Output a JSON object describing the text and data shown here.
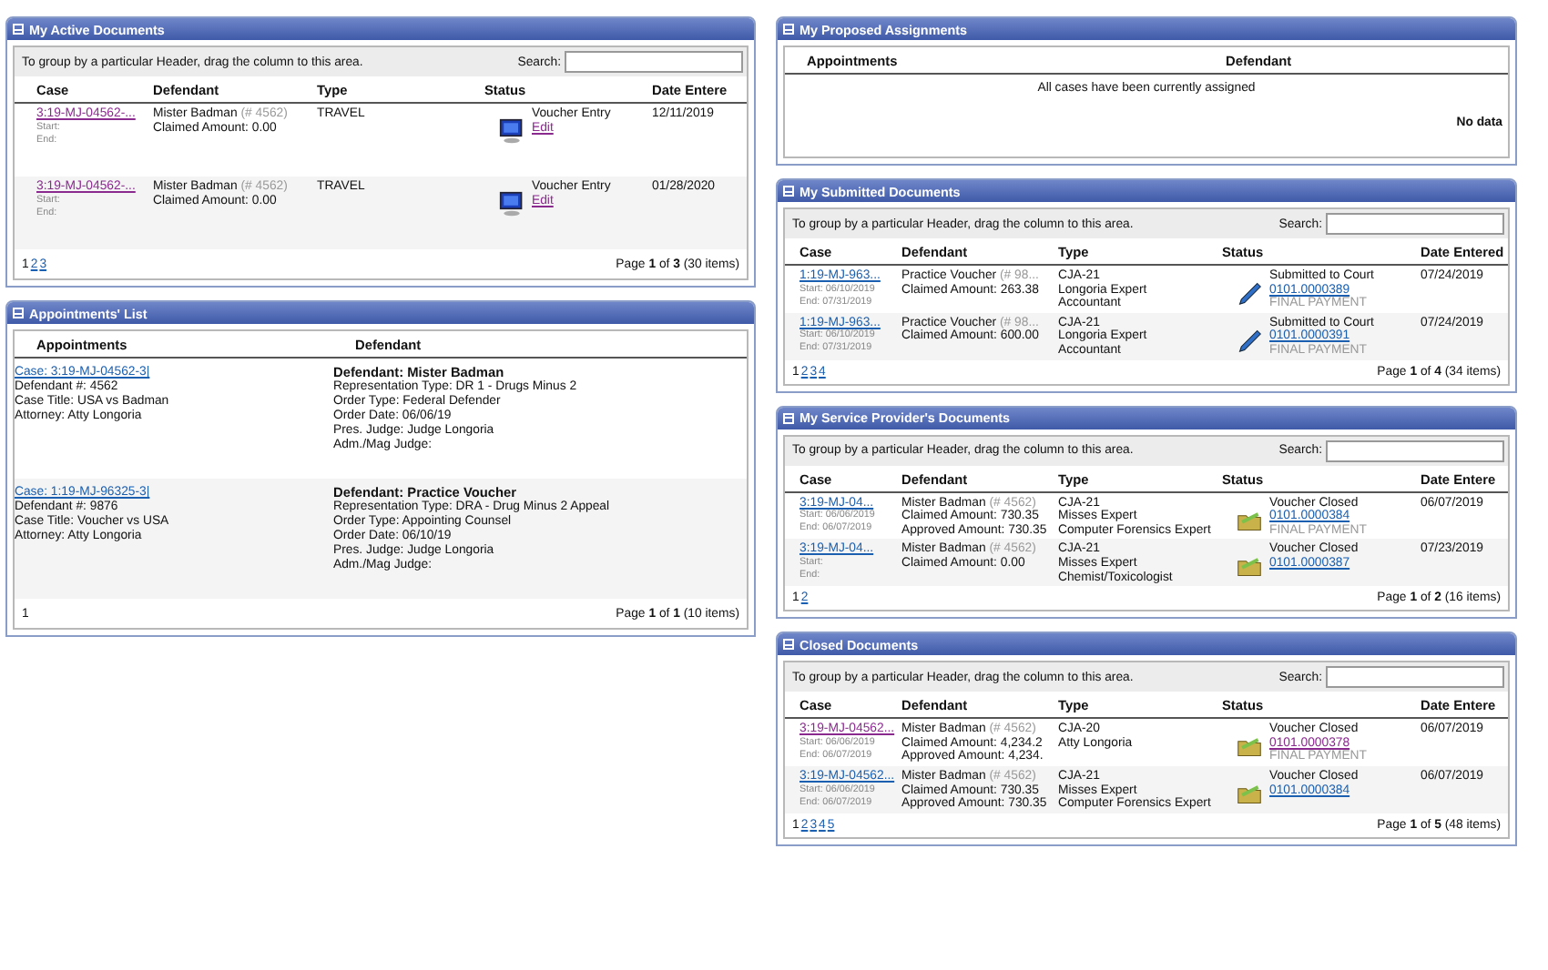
{
  "left_panels": [
    {
      "kind": "documents",
      "title": "My Active Documents",
      "group_hint": "To group by a particular Header, drag the column to this area.",
      "search_label": "Search:",
      "columns": [
        "Case",
        "Defendant",
        "Type",
        "Status",
        "Date Entere"
      ],
      "rows": [
        {
          "case": {
            "text": "3:19-MJ-04562-...",
            "visited": true
          },
          "start": "Start:",
          "end": "End:",
          "defendant": "Mister Badman",
          "defendant_no": "(# 4562)",
          "amounts": [
            "Claimed Amount: 0.00"
          ],
          "type": [
            "TRAVEL"
          ],
          "status": {
            "kind": "entry",
            "text": "Voucher Entry",
            "link": "Edit",
            "visited": true
          },
          "date": "12/11/2019"
        },
        {
          "case": {
            "text": "3:19-MJ-04562-...",
            "visited": true
          },
          "start": "Start:",
          "end": "End:",
          "defendant": "Mister Badman",
          "defendant_no": "(# 4562)",
          "amounts": [
            "Claimed Amount: 0.00"
          ],
          "type": [
            "TRAVEL"
          ],
          "status": {
            "kind": "entry",
            "text": "Voucher Entry",
            "link": "Edit",
            "visited": true
          },
          "date": "01/28/2020"
        }
      ],
      "pages": [
        {
          "label": "1",
          "selected": true
        },
        {
          "label": "2",
          "selected": false
        },
        {
          "label": "3",
          "selected": false
        }
      ],
      "page_info": "Page **1** of **3** (30 items)"
    },
    {
      "kind": "appointments",
      "title": "Appointments' List",
      "columns": [
        "Appointments",
        "Defendant"
      ],
      "rows": [
        {
          "case": "Case: 3:19-MJ-04562-3|",
          "lines": [
            "Defendant #: 4562",
            "Case Title: USA vs Badman",
            "Attorney: Atty Longoria"
          ],
          "defendant": "Defendant: Mister Badman",
          "details": [
            "Representation Type: DR 1 - Drugs Minus 2",
            "Order Type: Federal Defender",
            "Order Date: 06/06/19",
            "Pres. Judge: Judge Longoria",
            "Adm./Mag Judge:"
          ]
        },
        {
          "case": "Case: 1:19-MJ-96325-3|",
          "lines": [
            "Defendant #: 9876",
            "Case Title: Voucher vs USA",
            "Attorney: Atty Longoria"
          ],
          "defendant": "Defendant: Practice Voucher",
          "details": [
            "Representation Type: DRA - Drug Minus 2 Appeal",
            "Order Type: Appointing Counsel",
            "Order Date: 06/10/19",
            "Pres. Judge: Judge Longoria",
            "Adm./Mag Judge:"
          ]
        }
      ],
      "pages": [
        {
          "label": "1",
          "selected": true
        }
      ],
      "page_info": "Page **1** of **1** (10 items)"
    }
  ],
  "right_panels": [
    {
      "kind": "proposed",
      "title": "My Proposed Assignments",
      "columns": [
        "Appointments",
        "Defendant"
      ],
      "message": "All cases have been currently assigned",
      "footer": "No data"
    },
    {
      "kind": "documents",
      "title": "My Submitted Documents",
      "group_hint": "To group by a particular Header, drag the column to this area.",
      "search_label": "Search:",
      "columns": [
        "Case",
        "Defendant",
        "Type",
        "Status",
        "Date Entered"
      ],
      "rows": [
        {
          "case": {
            "text": "1:19-MJ-963...",
            "visited": false
          },
          "start": "Start: 06/10/2019",
          "end": "End: 07/31/2019",
          "defendant": "Practice Voucher",
          "defendant_no": "(# 98...",
          "amounts": [
            "Claimed Amount: 263.38"
          ],
          "type": [
            "CJA-21",
            "Longoria Expert",
            "Accountant"
          ],
          "status": {
            "kind": "submitted",
            "text": "Submitted to Court",
            "link": "0101.0000389",
            "visited": false,
            "note": "FINAL PAYMENT"
          },
          "date": "07/24/2019"
        },
        {
          "case": {
            "text": "1:19-MJ-963...",
            "visited": false
          },
          "start": "Start: 06/10/2019",
          "end": "End: 07/31/2019",
          "defendant": "Practice Voucher",
          "defendant_no": "(# 98...",
          "amounts": [
            "Claimed Amount: 600.00"
          ],
          "type": [
            "CJA-21",
            "Longoria Expert",
            "Accountant"
          ],
          "status": {
            "kind": "submitted",
            "text": "Submitted to Court",
            "link": "0101.0000391",
            "visited": false,
            "note": "FINAL PAYMENT"
          },
          "date": "07/24/2019"
        }
      ],
      "pages": [
        {
          "label": "1",
          "selected": true
        },
        {
          "label": "2",
          "selected": false
        },
        {
          "label": "3",
          "selected": false
        },
        {
          "label": "4",
          "selected": false
        }
      ],
      "page_info": "Page **1** of **4** (34 items)"
    },
    {
      "kind": "documents",
      "title": "My Service Provider's Documents",
      "group_hint": "To group by a particular Header, drag the column to this area.",
      "search_label": "Search:",
      "columns": [
        "Case",
        "Defendant",
        "Type",
        "Status",
        "Date Entere"
      ],
      "rows": [
        {
          "case": {
            "text": "3:19-MJ-04...",
            "visited": false
          },
          "start": "Start: 06/06/2019",
          "end": "End: 06/07/2019",
          "defendant": "Mister Badman",
          "defendant_no": "(# 4562)",
          "amounts": [
            "Claimed Amount: 730.35",
            "Approved Amount: 730.35"
          ],
          "type": [
            "CJA-21",
            "Misses Expert",
            "Computer Forensics Expert"
          ],
          "status": {
            "kind": "closed",
            "text": "Voucher Closed",
            "link": "0101.0000384",
            "visited": false,
            "note": "FINAL PAYMENT"
          },
          "date": "06/07/2019"
        },
        {
          "case": {
            "text": "3:19-MJ-04...",
            "visited": false
          },
          "start": "Start:",
          "end": "End:",
          "defendant": "Mister Badman",
          "defendant_no": "(# 4562)",
          "amounts": [
            "Claimed Amount: 0.00"
          ],
          "type": [
            "CJA-21",
            "Misses Expert",
            "Chemist/Toxicologist"
          ],
          "status": {
            "kind": "closed",
            "text": "Voucher Closed",
            "link": "0101.0000387",
            "visited": false
          },
          "date": "07/23/2019"
        }
      ],
      "pages": [
        {
          "label": "1",
          "selected": true
        },
        {
          "label": "2",
          "selected": false
        }
      ],
      "page_info": "Page **1** of **2** (16 items)"
    },
    {
      "kind": "documents",
      "title": "Closed Documents",
      "group_hint": "To group by a particular Header, drag the column to this area.",
      "search_label": "Search:",
      "columns": [
        "Case",
        "Defendant",
        "Type",
        "Status",
        "Date Entere"
      ],
      "rows": [
        {
          "case": {
            "text": "3:19-MJ-04562...",
            "visited": true
          },
          "start": "Start: 06/06/2019",
          "end": "End: 06/07/2019",
          "defendant": "Mister Badman",
          "defendant_no": "(# 4562)",
          "amounts": [
            "Claimed Amount: 4,234.2",
            "Approved Amount: 4,234."
          ],
          "type": [
            "CJA-20",
            "Atty Longoria"
          ],
          "status": {
            "kind": "closed",
            "text": "Voucher Closed",
            "link": "0101.0000378",
            "visited": true,
            "note": "FINAL PAYMENT"
          },
          "date": "06/07/2019"
        },
        {
          "case": {
            "text": "3:19-MJ-04562...",
            "visited": false
          },
          "start": "Start: 06/06/2019",
          "end": "End: 06/07/2019",
          "defendant": "Mister Badman",
          "defendant_no": "(# 4562)",
          "amounts": [
            "Claimed Amount: 730.35",
            "Approved Amount: 730.35"
          ],
          "type": [
            "CJA-21",
            "Misses Expert",
            "Computer Forensics Expert"
          ],
          "status": {
            "kind": "closed",
            "text": "Voucher Closed",
            "link": "0101.0000384",
            "visited": false
          },
          "date": "06/07/2019"
        }
      ],
      "pages": [
        {
          "label": "1",
          "selected": true
        },
        {
          "label": "2",
          "selected": false
        },
        {
          "label": "3",
          "selected": false
        },
        {
          "label": "4",
          "selected": false
        },
        {
          "label": "5",
          "selected": false
        }
      ],
      "page_info": "Page **1** of **5** (48 items)"
    }
  ]
}
